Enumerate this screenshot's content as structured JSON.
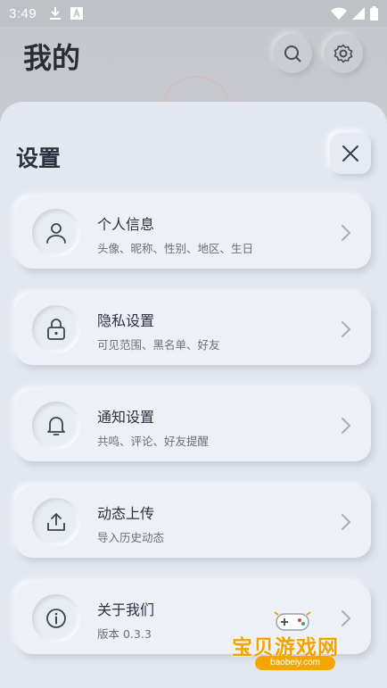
{
  "status_bar": {
    "time": "3:49"
  },
  "background_page": {
    "title": "我的"
  },
  "sheet": {
    "title": "设置",
    "items": [
      {
        "title": "个人信息",
        "subtitle": "头像、昵称、性别、地区、生日",
        "icon": "user-icon"
      },
      {
        "title": "隐私设置",
        "subtitle": "可见范围、黑名单、好友",
        "icon": "lock-icon"
      },
      {
        "title": "通知设置",
        "subtitle": "共鸣、评论、好友提醒",
        "icon": "bell-icon"
      },
      {
        "title": "动态上传",
        "subtitle": "导入历史动态",
        "icon": "upload-icon"
      },
      {
        "title": "关于我们",
        "subtitle": "版本 0.3.3",
        "icon": "info-icon"
      }
    ]
  },
  "watermark": {
    "text": "宝贝游戏网",
    "url": "baobeiy.com"
  },
  "colors": {
    "sheet_bg": "#e3e7ef",
    "title": "#2c3140",
    "subtitle": "#6a6f7b",
    "watermark": "#f3a200"
  }
}
